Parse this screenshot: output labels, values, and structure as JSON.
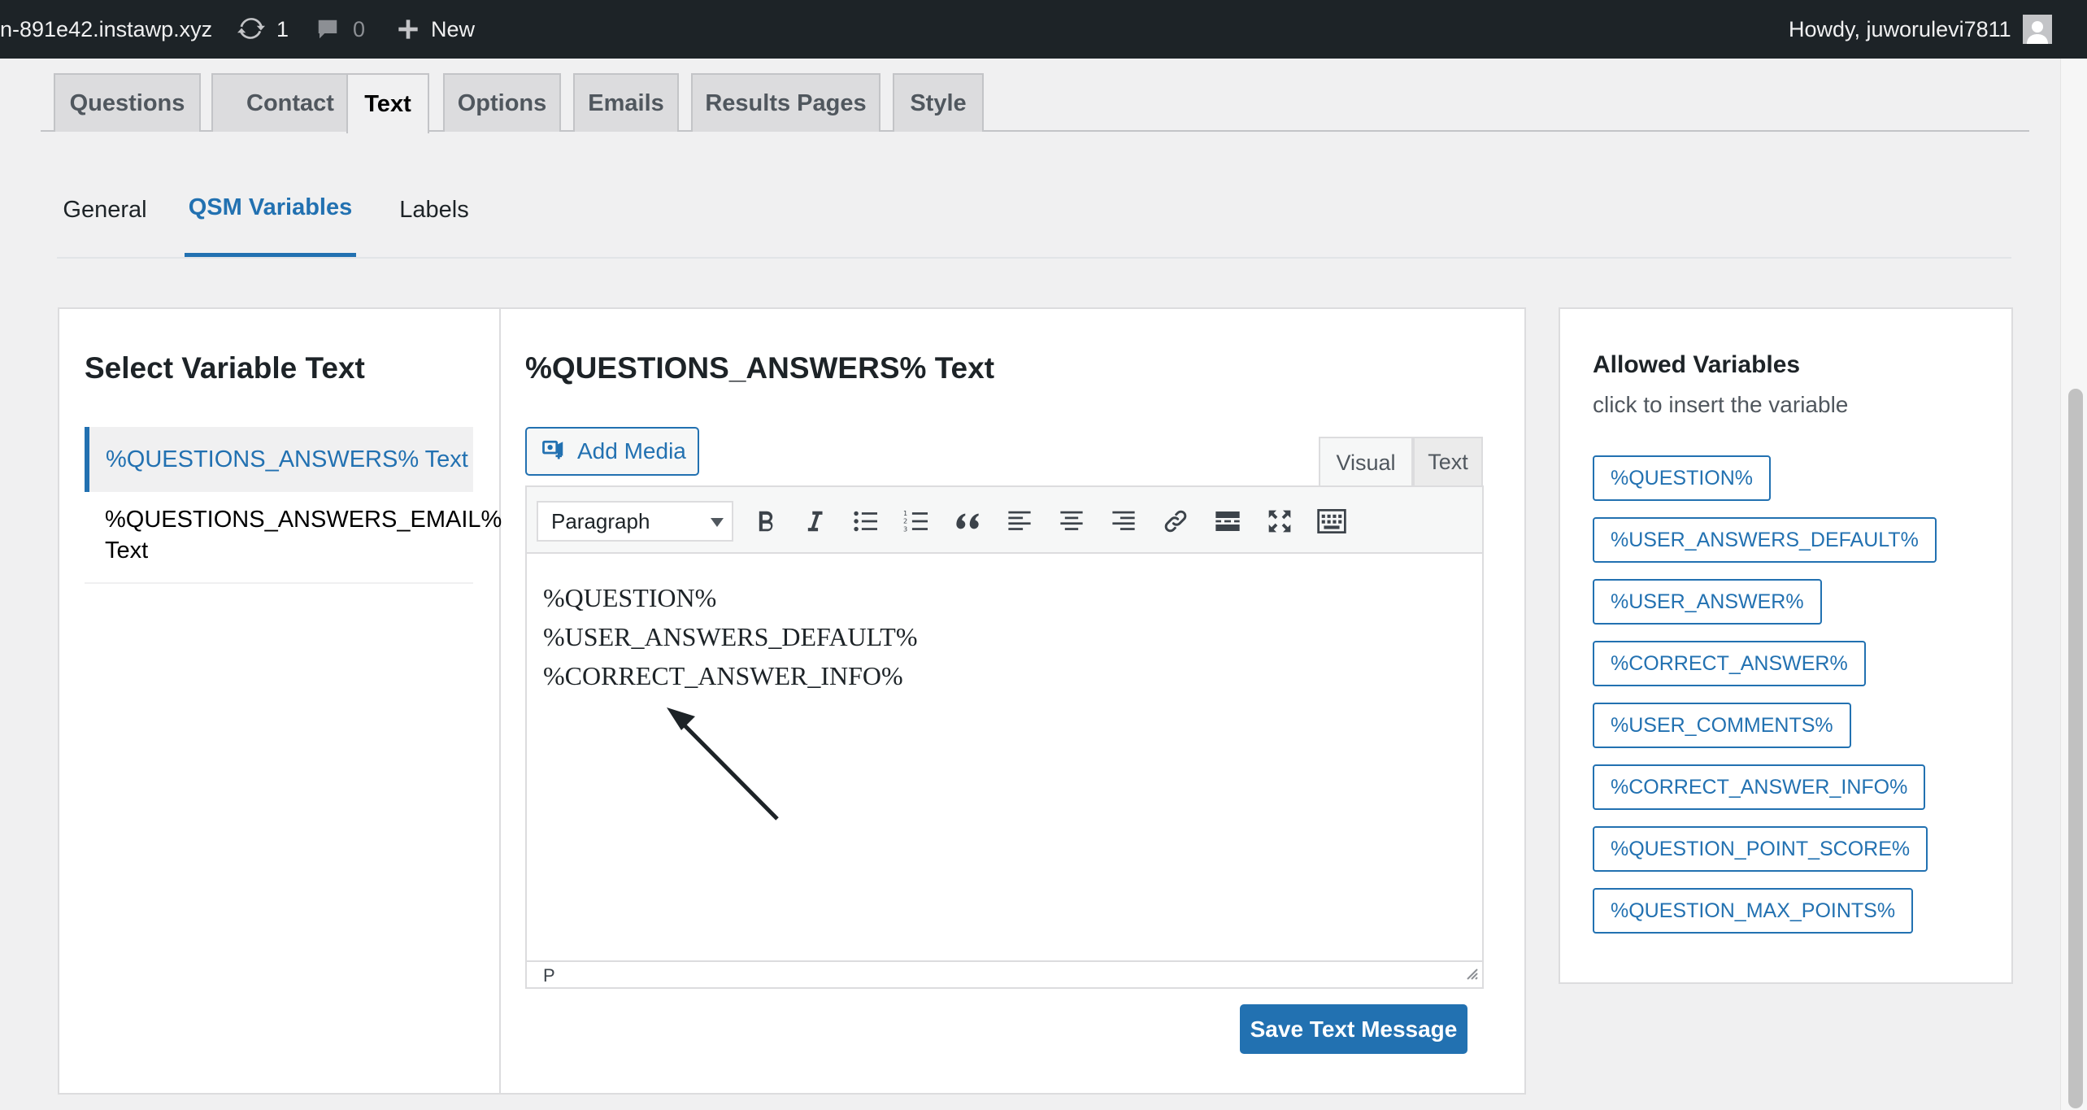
{
  "adminbar": {
    "site_name": "n-891e42.instawp.xyz",
    "updates_count": "1",
    "comments_count": "0",
    "new_label": "New",
    "howdy": "Howdy, juworulevi7811"
  },
  "main_tabs": [
    {
      "label": "Questions"
    },
    {
      "label": "Contact"
    },
    {
      "label": "Text"
    },
    {
      "label": "Options"
    },
    {
      "label": "Emails"
    },
    {
      "label": "Results Pages"
    },
    {
      "label": "Style"
    }
  ],
  "active_main_tab": "Text",
  "sub_tabs": [
    {
      "label": "General"
    },
    {
      "label": "QSM Variables"
    },
    {
      "label": "Labels"
    }
  ],
  "active_sub_tab": "QSM Variables",
  "left": {
    "title": "Select Variable Text",
    "items": [
      {
        "label": "%QUESTIONS_ANSWERS% Text"
      },
      {
        "label_line1": "%QUESTIONS_ANSWERS_EMAIL%",
        "label_line2": "Text"
      }
    ]
  },
  "editor": {
    "title": "%QUESTIONS_ANSWERS% Text",
    "add_media_label": "Add Media",
    "tab_visual": "Visual",
    "tab_text": "Text",
    "format_value": "Paragraph",
    "toolbar_icons": [
      "bold-icon",
      "italic-icon",
      "bulleted-list-icon",
      "numbered-list-icon",
      "blockquote-icon",
      "align-left-icon",
      "align-center-icon",
      "align-right-icon",
      "link-icon",
      "read-more-icon",
      "fullscreen-icon",
      "toolbar-toggle-icon"
    ],
    "content_lines": [
      "%QUESTION%",
      "%USER_ANSWERS_DEFAULT%",
      "%CORRECT_ANSWER_INFO%"
    ],
    "status_path": "P",
    "save_label": "Save Text Message"
  },
  "right": {
    "title": "Allowed Variables",
    "subtitle": "click to insert the variable",
    "variables": [
      "%QUESTION%",
      "%USER_ANSWERS_DEFAULT%",
      "%USER_ANSWER%",
      "%CORRECT_ANSWER%",
      "%USER_COMMENTS%",
      "%CORRECT_ANSWER_INFO%",
      "%QUESTION_POINT_SCORE%",
      "%QUESTION_MAX_POINTS%"
    ]
  },
  "colors": {
    "accent": "#2271b1",
    "adminbar_bg": "#1d2327",
    "annotation_arrow": "#1d2327"
  }
}
